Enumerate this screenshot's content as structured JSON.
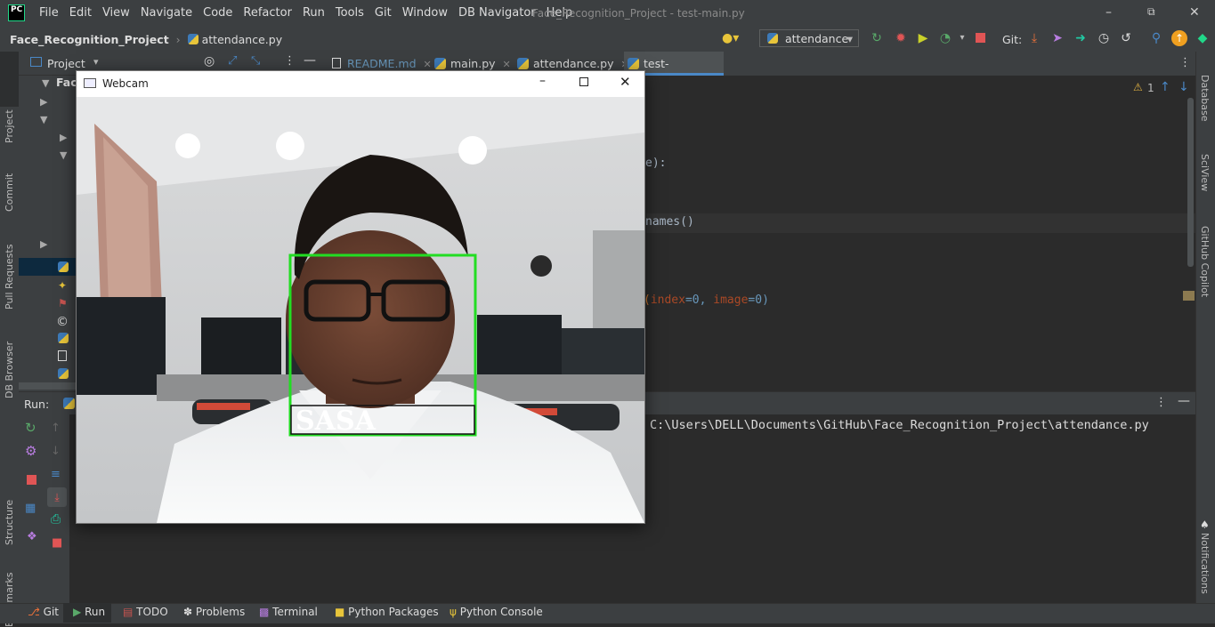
{
  "app": {
    "logo": "PC",
    "menu": [
      "File",
      "Edit",
      "View",
      "Navigate",
      "Code",
      "Refactor",
      "Run",
      "Tools",
      "Git",
      "Window",
      "DB Navigator",
      "Help"
    ],
    "window_title": "Face_Recognition_Project - test-main.py"
  },
  "breadcrumb": {
    "project": "Face_Recognition_Project",
    "file": "attendance.py"
  },
  "toolbar": {
    "run_config": "attendance",
    "git_label": "Git:"
  },
  "project_panel": {
    "title": "Project",
    "root_label": "Face"
  },
  "tabs": [
    {
      "label": "README.md"
    },
    {
      "label": "main.py"
    },
    {
      "label": "attendance.py"
    },
    {
      "label": "test-main.py"
    }
  ],
  "editor": {
    "warning_count": "1",
    "line1": "e):",
    "line2": "names()",
    "line3_a": "(",
    "line3_b": "index",
    "line3_c": "=0, ",
    "line3_d": "image",
    "line3_e": "=0)"
  },
  "run_panel": {
    "title": "Run:",
    "console_line": "C:\\Users\\DELL\\Documents\\GitHub\\Face_Recognition_Project\\attendance.py"
  },
  "left_tabs": [
    "Project",
    "Commit",
    "Pull Requests",
    "DB Browser",
    "Structure",
    "Bookmarks"
  ],
  "right_tabs": [
    "Database",
    "SciView",
    "GitHub Copilot",
    "Notifications"
  ],
  "bottom_tabs": [
    "Git",
    "Run",
    "TODO",
    "Problems",
    "Terminal",
    "Python Packages",
    "Python Console"
  ],
  "webcam": {
    "title": "Webcam",
    "detected_name": "SASA"
  },
  "colors": {
    "accent": "#4a88c7",
    "detection_box": "#22dd22"
  }
}
